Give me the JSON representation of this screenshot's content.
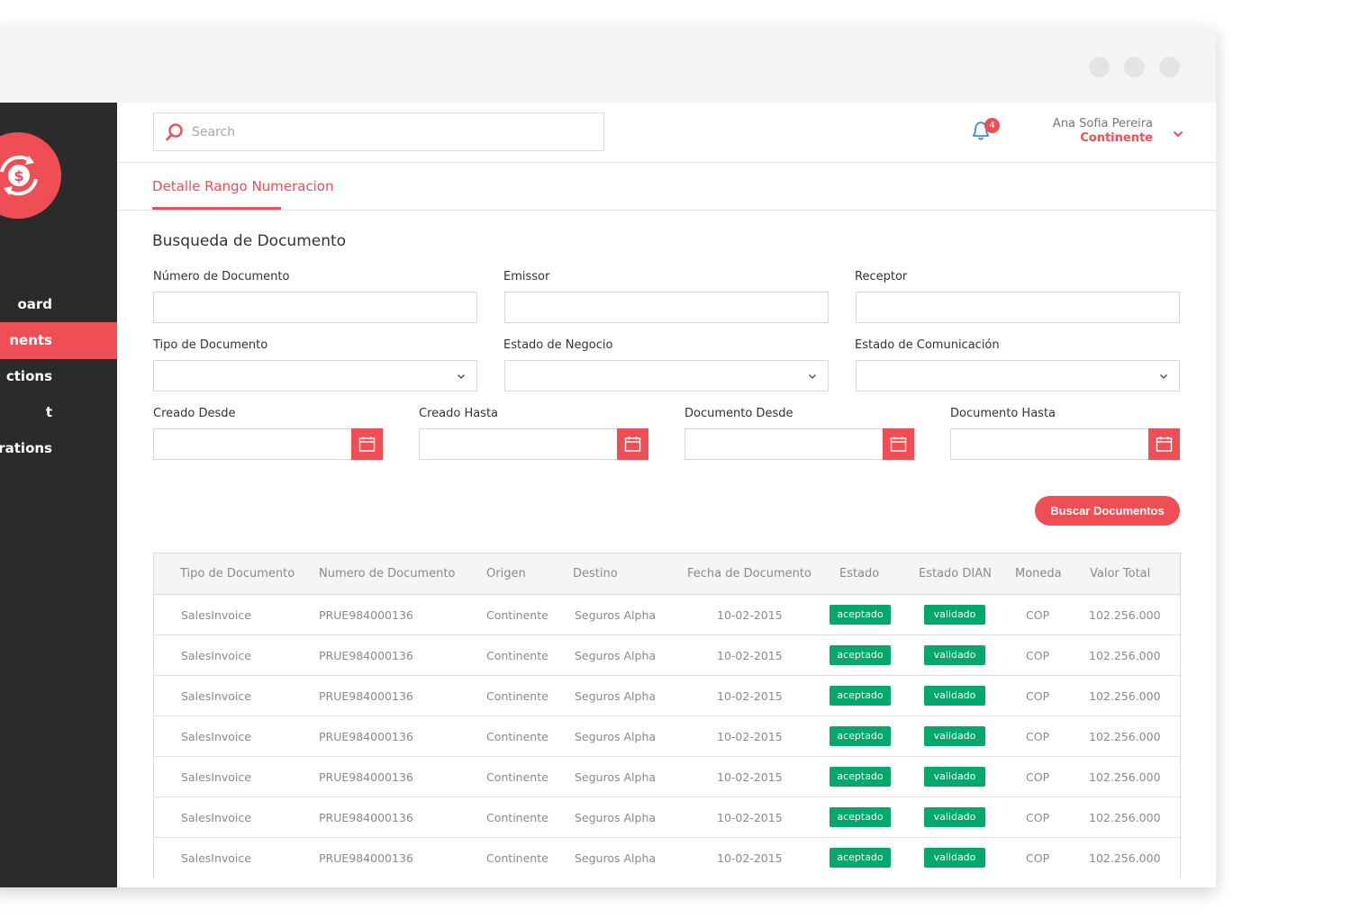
{
  "sidebar": {
    "items": [
      {
        "label": "Dashboard",
        "active": false
      },
      {
        "label": "Documents",
        "active": true
      },
      {
        "label": "Transactions",
        "active": false
      },
      {
        "label": "Report",
        "active": false
      },
      {
        "label": "Configurations",
        "active": false
      }
    ],
    "visible_fragments": [
      "oard",
      "nents",
      "ctions",
      "t",
      "urations"
    ]
  },
  "header": {
    "search_placeholder": "Search",
    "notifications_count": "4",
    "user_name": "Ana Sofia Pereira",
    "user_org": "Continente"
  },
  "tab": {
    "label": "Detalle Rango Numeracion"
  },
  "form": {
    "title": "Busqueda de Documento",
    "fields": {
      "numero_documento": "Número de Documento",
      "emisor": "Emissor",
      "receptor": "Receptor",
      "tipo_documento": "Tipo de Documento",
      "estado_negocio": "Estado de Negocio",
      "estado_comunicacion": "Estado de Comunicación",
      "creado_desde": "Creado Desde",
      "creado_hasta": "Creado Hasta",
      "documento_desde": "Documento Desde",
      "documento_hasta": "Documento Hasta"
    },
    "search_button": "Buscar Documentos"
  },
  "table": {
    "columns": [
      "Tipo de Documento",
      "Numero de Documento",
      "Origen",
      "Destino",
      "Fecha de Documento",
      "Estado",
      "Estado DIAN",
      "Moneda",
      "Valor Total"
    ],
    "rows": [
      [
        "SalesInvoice",
        "PRUE984000136",
        "Continente",
        "Seguros Alpha",
        "10-02-2015",
        "aceptado",
        "validado",
        "COP",
        "102.256.000"
      ],
      [
        "SalesInvoice",
        "PRUE984000136",
        "Continente",
        "Seguros Alpha",
        "10-02-2015",
        "aceptado",
        "validado",
        "COP",
        "102.256.000"
      ],
      [
        "SalesInvoice",
        "PRUE984000136",
        "Continente",
        "Seguros Alpha",
        "10-02-2015",
        "aceptado",
        "validado",
        "COP",
        "102.256.000"
      ],
      [
        "SalesInvoice",
        "PRUE984000136",
        "Continente",
        "Seguros Alpha",
        "10-02-2015",
        "aceptado",
        "validado",
        "COP",
        "102.256.000"
      ],
      [
        "SalesInvoice",
        "PRUE984000136",
        "Continente",
        "Seguros Alpha",
        "10-02-2015",
        "aceptado",
        "validado",
        "COP",
        "102.256.000"
      ],
      [
        "SalesInvoice",
        "PRUE984000136",
        "Continente",
        "Seguros Alpha",
        "10-02-2015",
        "aceptado",
        "validado",
        "COP",
        "102.256.000"
      ],
      [
        "SalesInvoice",
        "PRUE984000136",
        "Continente",
        "Seguros Alpha",
        "10-02-2015",
        "aceptado",
        "validado",
        "COP",
        "102.256.000"
      ]
    ]
  },
  "colors": {
    "accent": "#f04e55",
    "sidebar_bg": "#2b2b2b",
    "status_green": "#00a86b"
  }
}
